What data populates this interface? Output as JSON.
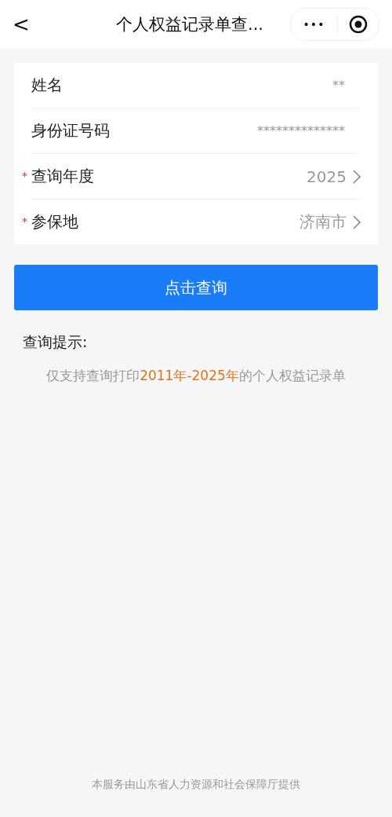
{
  "nav": {
    "back": "<",
    "title": "个人权益记录单查...",
    "more": "•••"
  },
  "form": [
    {
      "label": "姓名",
      "value": "**",
      "kind": "text",
      "required": false
    },
    {
      "label": "身份证号码",
      "value": "**************",
      "kind": "text",
      "required": false
    },
    {
      "label": "查询年度",
      "value": "2025",
      "kind": "select",
      "required": true
    },
    {
      "label": "参保地",
      "value": "济南市",
      "kind": "select",
      "required": true
    }
  ],
  "required_mark": "*",
  "submit": "点击查询",
  "hint": {
    "title": "查询提示:",
    "text": "仅支持查询打印**2011年-2025年**的个人权益记录单"
  },
  "footer": "本服务由山东省人力资源和社会保障厅提供"
}
